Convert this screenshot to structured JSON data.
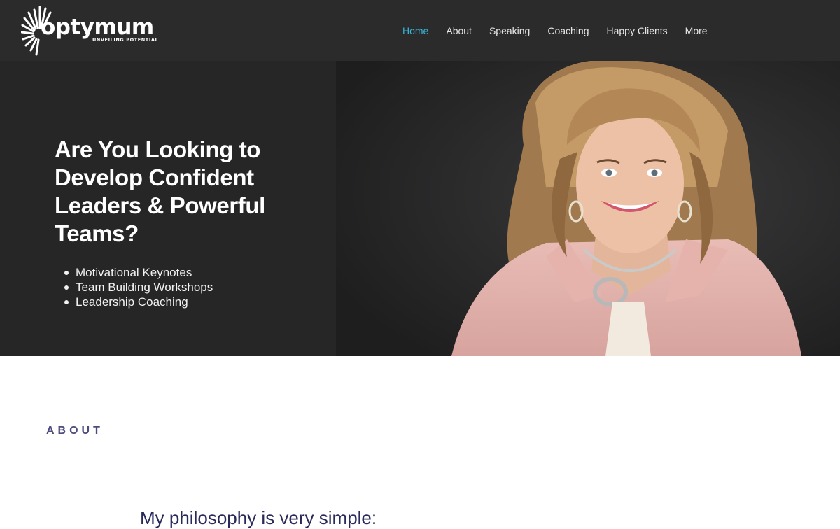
{
  "brand": {
    "name": "optymum",
    "tagline": "UNVEILING POTENTIAL",
    "logo_icon": "sunburst-icon",
    "color": "#ffffff"
  },
  "nav": {
    "items": [
      {
        "label": "Home",
        "active": true
      },
      {
        "label": "About",
        "active": false
      },
      {
        "label": "Speaking",
        "active": false
      },
      {
        "label": "Coaching",
        "active": false
      },
      {
        "label": "Happy Clients",
        "active": false
      },
      {
        "label": "More",
        "active": false
      }
    ],
    "active_color": "#38b6d8",
    "text_color": "#e6e6e6"
  },
  "hero": {
    "headline": "Are You Looking to Develop Confident Leaders & Powerful Teams?",
    "bullets": [
      "Motivational Keynotes",
      "Team Building Workshops",
      "Leadership Coaching"
    ],
    "background_color": "#262627",
    "photo": "portrait-photo"
  },
  "about": {
    "label": "ABOUT",
    "intro": "My philosophy is very simple:",
    "label_color": "#4d4a7d"
  }
}
